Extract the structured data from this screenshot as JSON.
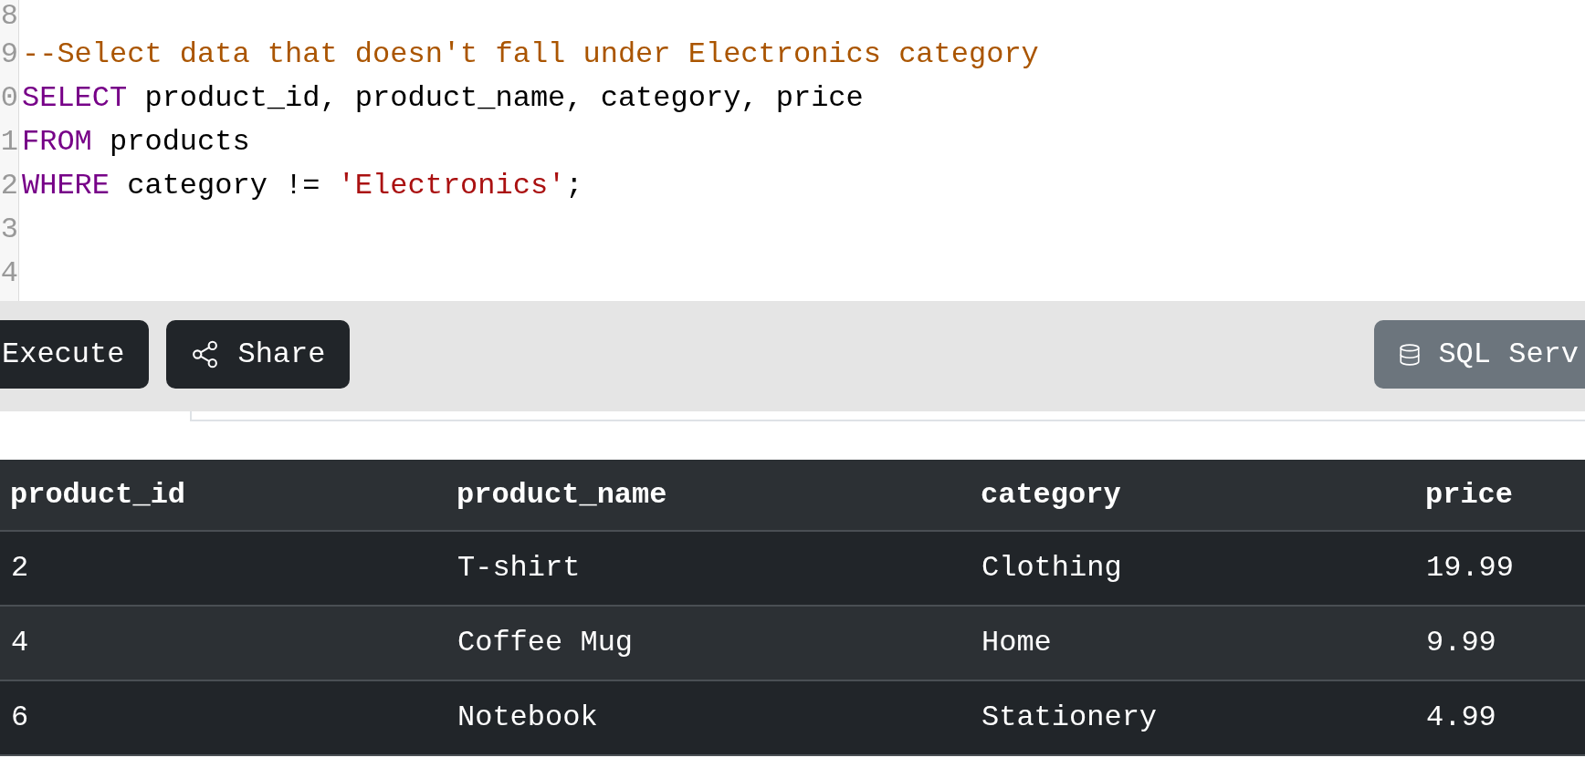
{
  "editor": {
    "lines": [
      {
        "number": "8"
      },
      {
        "number": "9",
        "tokens": [
          {
            "kind": "comment",
            "text": "--Select data that doesn't fall under Electronics category"
          }
        ]
      },
      {
        "number": "0",
        "tokens": [
          {
            "kind": "keyword",
            "text": "SELECT"
          },
          {
            "kind": "plain",
            "text": " product_id, product_name, category, price"
          }
        ]
      },
      {
        "number": "1",
        "tokens": [
          {
            "kind": "keyword",
            "text": "FROM"
          },
          {
            "kind": "plain",
            "text": " products"
          }
        ]
      },
      {
        "number": "2",
        "tokens": [
          {
            "kind": "keyword",
            "text": "WHERE"
          },
          {
            "kind": "plain",
            "text": " category != "
          },
          {
            "kind": "string",
            "text": "'Electronics'"
          },
          {
            "kind": "plain",
            "text": ";"
          }
        ]
      },
      {
        "number": "3"
      },
      {
        "number": "4"
      }
    ]
  },
  "toolbar": {
    "buttons": [
      {
        "kind": "execute",
        "label": "Execute"
      },
      {
        "kind": "share",
        "label": "Share"
      }
    ],
    "engine": {
      "label": "SQL Serv"
    }
  },
  "results": {
    "columns": [
      "product_id",
      "product_name",
      "category",
      "price"
    ],
    "rows": [
      [
        "2",
        "T-shirt",
        "Clothing",
        "19.99"
      ],
      [
        "4",
        "Coffee Mug",
        "Home",
        "9.99"
      ],
      [
        "6",
        "Notebook",
        "Stationery",
        "4.99"
      ]
    ]
  }
}
